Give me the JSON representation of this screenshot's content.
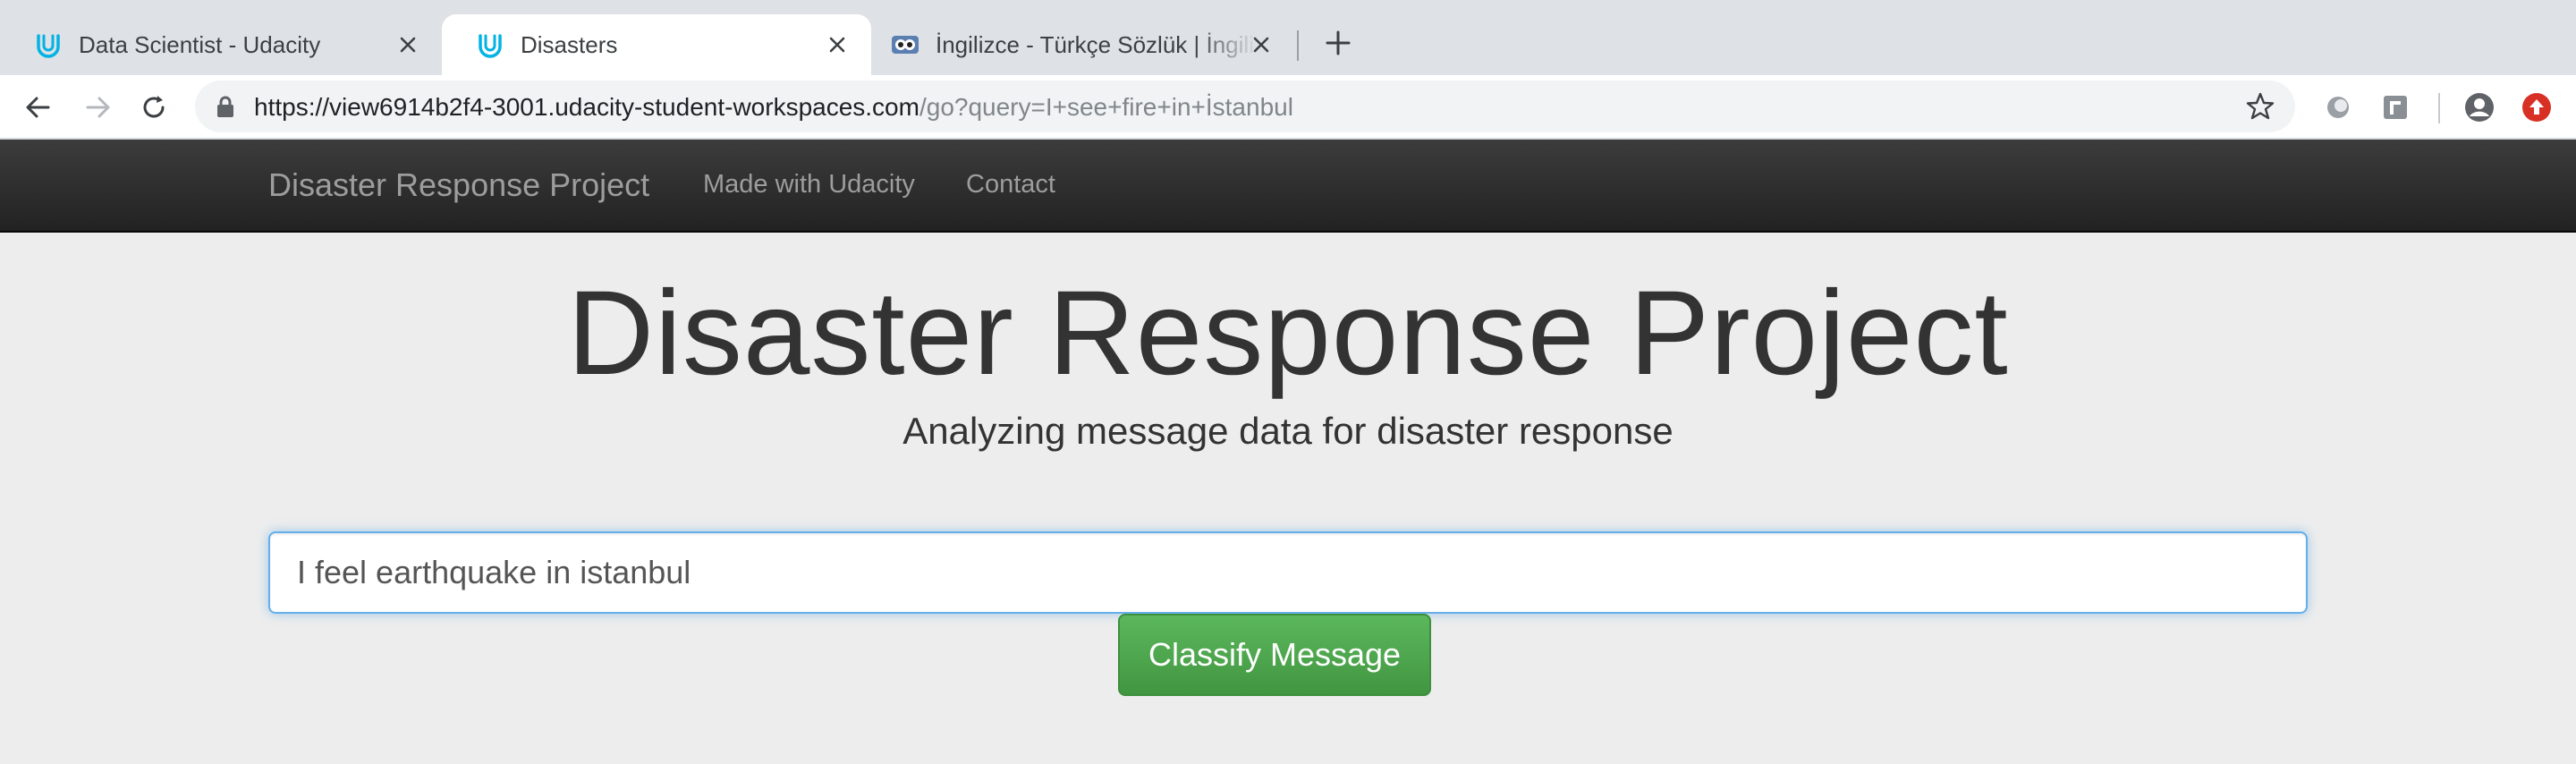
{
  "browser": {
    "tabs": [
      {
        "title": "Data Scientist - Udacity",
        "favicon": "udacity-icon",
        "active": false
      },
      {
        "title": "Disasters",
        "favicon": "udacity-icon",
        "active": true
      },
      {
        "title": "İngilizce - Türkçe Sözlük | İngilizce",
        "favicon": "sozluk-owl-icon",
        "active": false
      }
    ],
    "url_host": "https://view6914b2f4-3001.udacity-student-workspaces.com",
    "url_path": "/go?query=I+see+fire+in+İstanbul",
    "toolbar_icons": [
      "back-arrow-icon",
      "forward-arrow-icon",
      "reload-icon",
      "lock-icon",
      "star-icon",
      "extension-circle-icon",
      "extension-square-icon",
      "profile-icon",
      "update-icon"
    ]
  },
  "navbar": {
    "brand": "Disaster Response Project",
    "links": [
      "Made with Udacity",
      "Contact"
    ]
  },
  "jumbotron": {
    "title": "Disaster Response Project",
    "subtitle": "Analyzing message data for disaster response"
  },
  "form": {
    "query_value": "I feel earthquake in istanbul",
    "button_label": "Classify Message"
  },
  "colors": {
    "tab_strip": "#dee1e6",
    "navbar": "#222222",
    "page_background": "#ededed",
    "button_green": "#5cb85c",
    "input_focus_border": "#66afe9"
  }
}
